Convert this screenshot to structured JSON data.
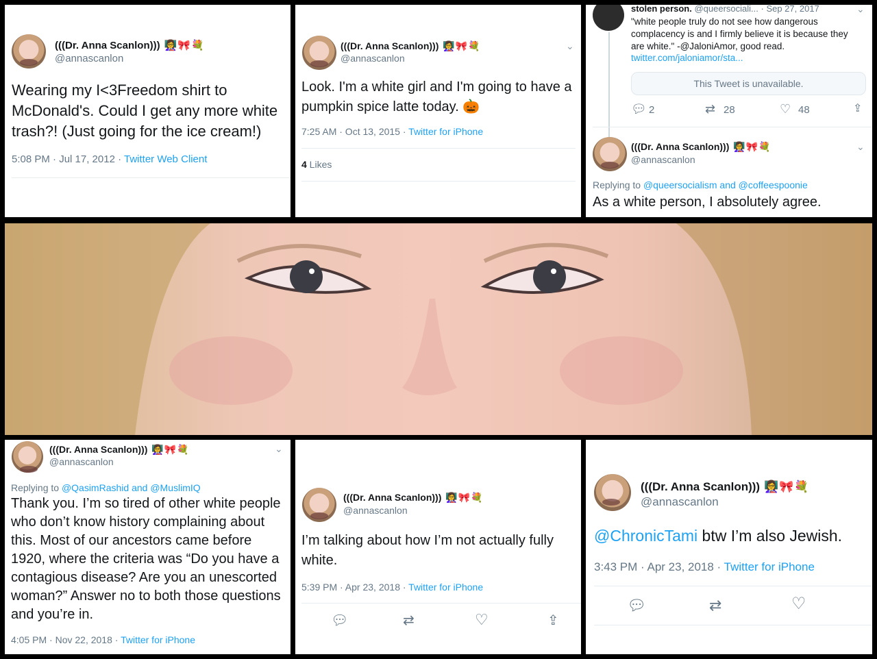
{
  "author": {
    "name": "(((Dr. Anna Scanlon)))",
    "emoji": "👩‍🏫🎀💐",
    "handle": "@annascanlon"
  },
  "tweet1": {
    "text": "Wearing my I<3Freedom shirt to McDonald's. Could I get any more white trash?! (Just going for the ice cream!)",
    "time": "5:08 PM · Jul 17, 2012 · ",
    "source": "Twitter Web Client"
  },
  "tweet2": {
    "text": "Look. I'm a white girl and I'm going to have a pumpkin spice latte today. 🎃",
    "time": "7:25 AM · Oct 13, 2015 · ",
    "source": "Twitter for iPhone",
    "likes_count": "4",
    "likes_label": " Likes"
  },
  "tweet3": {
    "quoted_name": "stolen person.",
    "quoted_handle_date": "@queersociali...  · Sep 27, 2017",
    "quoted_text": "\"white people truly do not see how dangerous complacency is and I firmly believe it is because they are white.\" -@JaloniAmor, good read.",
    "quoted_link": "twitter.com/jaloniamor/sta...",
    "unavailable": "This Tweet is unavailable.",
    "replies": "2",
    "retweets": "28",
    "likes": "48",
    "replying_label": "Replying to ",
    "replying_users": "@queersocialism and @coffeespoonie",
    "text": "As a white person, I absolutely agree."
  },
  "tweet4": {
    "replying_label": "Replying to ",
    "replying_users": "@QasimRashid and @MuslimIQ",
    "text": "Thank you. I’m so tired of other white people who don’t know history complaining about this. Most of our ancestors came before 1920, where the criteria was “Do you have a contagious disease? Are you an unescorted woman?” Answer no to both those questions and you’re in.",
    "time": "4:05 PM · Nov 22, 2018 · ",
    "source": "Twitter for iPhone"
  },
  "tweet5": {
    "text": "I’m talking about how I’m not actually fully white.",
    "time": "5:39 PM · Apr 23, 2018 · ",
    "source": "Twitter for iPhone"
  },
  "tweet6": {
    "mention": "@ChronicTami",
    "text": " btw I’m also Jewish.",
    "time": "3:43 PM · Apr 23, 2018 · ",
    "source": "Twitter for iPhone"
  },
  "icons": {
    "reply": "reply-icon",
    "retweet": "retweet-icon",
    "like": "like-icon",
    "share": "share-icon",
    "chevron": "chevron-down-icon"
  },
  "colors": {
    "link": "#1da1f2",
    "secondary_text": "#657786",
    "primary_text": "#14171a",
    "background": "#000000"
  }
}
